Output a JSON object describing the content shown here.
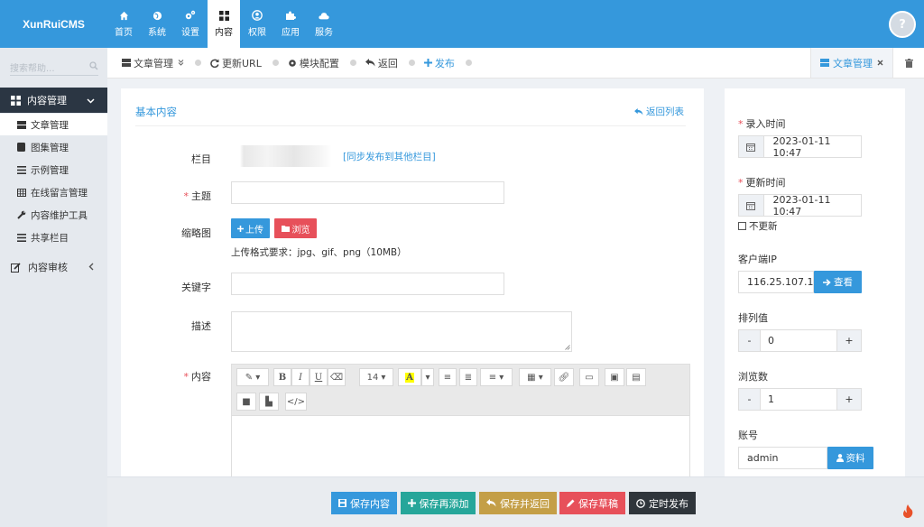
{
  "app": {
    "logo": "XunRuiCMS"
  },
  "nav": [
    {
      "label": "首页",
      "icon": "home-icon"
    },
    {
      "label": "系统",
      "icon": "globe-icon"
    },
    {
      "label": "设置",
      "icon": "gears-icon"
    },
    {
      "label": "内容",
      "icon": "grid-icon"
    },
    {
      "label": "权限",
      "icon": "user-circle-icon"
    },
    {
      "label": "应用",
      "icon": "puzzle-icon"
    },
    {
      "label": "服务",
      "icon": "cloud-icon"
    }
  ],
  "avatar": {
    "text": "?"
  },
  "sidebar": {
    "search_placeholder": "搜索帮助...",
    "group": "内容管理",
    "items": [
      {
        "label": "文章管理",
        "icon": "article-icon"
      },
      {
        "label": "图集管理",
        "icon": "book-icon"
      },
      {
        "label": "示例管理",
        "icon": "list-icon"
      },
      {
        "label": "在线留言管理",
        "icon": "table-icon"
      },
      {
        "label": "内容维护工具",
        "icon": "wrench-icon"
      },
      {
        "label": "共享栏目",
        "icon": "list-icon"
      }
    ],
    "audit": "内容审核"
  },
  "toolbar": {
    "items": [
      "文章管理",
      "更新URL",
      "模块配置",
      "返回",
      "发布"
    ],
    "tab": "文章管理"
  },
  "form": {
    "section_title": "基本内容",
    "back_list": "返回列表",
    "labels": {
      "category": "栏目",
      "subject": "主题",
      "thumb": "缩略图",
      "keywords": "关键字",
      "description": "描述",
      "content": "内容"
    },
    "sync_link": "[同步发布到其他栏目]",
    "upload_btn": "上传",
    "browse_btn": "浏览",
    "upload_hint": "上传格式要求：jpg、gif、png（10MB）",
    "editor_fontsize": "14"
  },
  "right": {
    "entry_time_label": "录入时间",
    "entry_time": "2023-01-11 10:47",
    "update_time_label": "更新时间",
    "update_time": "2023-01-11 10:47",
    "no_update": "不更新",
    "ip_label": "客户端IP",
    "ip_value": "116.25.107.1…",
    "view_btn": "查看",
    "sort_label": "排列值",
    "sort_value": "0",
    "hits_label": "浏览数",
    "hits_value": "1",
    "account_label": "账号",
    "account_value": "admin",
    "profile_btn": "资料",
    "minus": "-",
    "plus": "+"
  },
  "actions": {
    "save": "保存内容",
    "save_add": "保存再添加",
    "save_back": "保存并返回",
    "save_draft": "保存草稿",
    "timed": "定时发布"
  },
  "colors": {
    "topbar": "#3598dc",
    "sidebar_active": "#2b3643",
    "btn_blue": "#3598dc",
    "btn_red": "#e7505a",
    "btn_green": "#26a69a",
    "btn_gold": "#c49f47",
    "btn_dark": "#2f353b"
  }
}
